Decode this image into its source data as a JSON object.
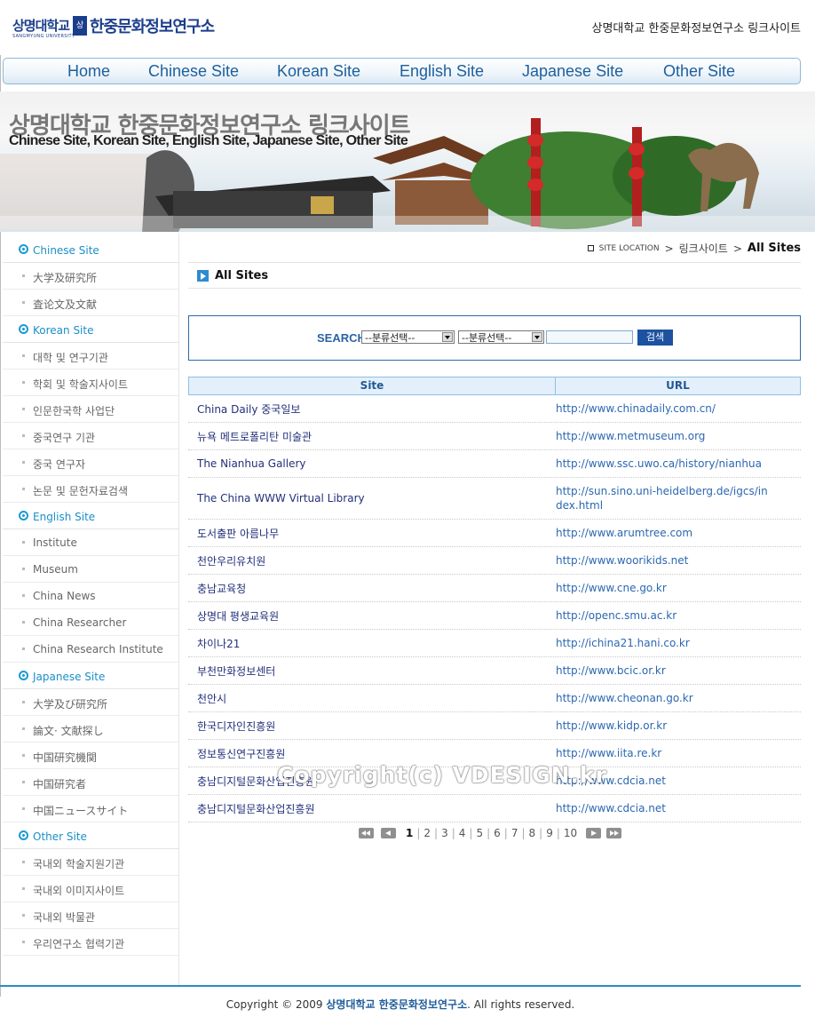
{
  "header": {
    "logo_univ": "상명대학교",
    "logo_univ_sub": "SANGMYUNG UNIVERSITY",
    "logo_seal": "상명",
    "logo_inst": "한중문화정보연구소",
    "site_title": "상명대학교 한중문화정보연구소 링크사이트"
  },
  "nav": [
    "Home",
    "Chinese Site",
    "Korean Site",
    "English Site",
    "Japanese Site",
    "Other Site"
  ],
  "banner": {
    "title": "상명대학교 한중문화정보연구소 링크사이트",
    "subtitle": "Chinese Site, Korean Site, English Site, Japanese Site, Other Site"
  },
  "sidebar": {
    "categories": [
      {
        "label": "Chinese Site",
        "items": [
          "大学及研究所",
          "査论文及文献"
        ]
      },
      {
        "label": "Korean Site",
        "items": [
          "대학 및 연구기관",
          "학회 및 학술지사이트",
          "인문한국학 사업단",
          "중국연구 기관",
          "중국 연구자",
          "논문 및 문헌자료검색"
        ]
      },
      {
        "label": "English Site",
        "items": [
          "Institute",
          "Museum",
          "China News",
          "China Researcher",
          "China Research Institute"
        ]
      },
      {
        "label": "Japanese Site",
        "items": [
          "大学及び研究所",
          "論文· 文献探し",
          "中国研究機関",
          "中国研究者",
          "中国ニュースサイト"
        ]
      },
      {
        "label": "Other Site",
        "items": [
          "국내외 학술지원기관",
          "국내외 이미지사이트",
          "국내외 박물관",
          "우리연구소 협력기관"
        ]
      }
    ]
  },
  "location": {
    "label": "SITE LOCATION",
    "sep": ">",
    "crumb": "링크사이트",
    "current": "All Sites"
  },
  "page_title": "All Sites",
  "search": {
    "label": "SEARCH",
    "select1": "--분류선택--",
    "select2": "--분류선택--",
    "query": "",
    "button": "검색"
  },
  "table": {
    "headers": [
      "Site",
      "URL"
    ],
    "rows": [
      {
        "site": "China Daily 중국일보",
        "url": "http://www.chinadaily.com.cn/"
      },
      {
        "site": "뉴욕 메트로폴리탄 미술관",
        "url": "http://www.metmuseum.org"
      },
      {
        "site": "The Nianhua Gallery",
        "url": "http://www.ssc.uwo.ca/history/nianhua"
      },
      {
        "site": "The China WWW Virtual Library",
        "url": "http://sun.sino.uni-heidelberg.de/igcs/index.html"
      },
      {
        "site": "도서출판 아름나무",
        "url": "http://www.arumtree.com"
      },
      {
        "site": "천안우리유치원",
        "url": "http://www.woorikids.net"
      },
      {
        "site": "충남교육청",
        "url": "http://www.cne.go.kr"
      },
      {
        "site": "상명대 평생교육원",
        "url": "http://openc.smu.ac.kr"
      },
      {
        "site": "차이나21",
        "url": "http://ichina21.hani.co.kr"
      },
      {
        "site": "부천만화정보센터",
        "url": "http://www.bcic.or.kr"
      },
      {
        "site": "천안시",
        "url": "http://www.cheonan.go.kr"
      },
      {
        "site": "한국디자인진흥원",
        "url": "http://www.kidp.or.kr"
      },
      {
        "site": "정보통신연구진흥원",
        "url": "http://www.iita.re.kr"
      },
      {
        "site": "충남디지털문화산업진흥원",
        "url": "http://www.cdcia.net"
      },
      {
        "site": "충남디지털문화산업진흥원",
        "url": "http://www.cdcia.net"
      }
    ]
  },
  "watermark": "Copyright(c) VDESIGN.kr",
  "pagination": {
    "current": "1",
    "pages": [
      "1",
      "2",
      "3",
      "4",
      "5",
      "6",
      "7",
      "8",
      "9",
      "10"
    ]
  },
  "footer": {
    "prefix": "Copyright © 2009 ",
    "brand": "상명대학교 한중문화정보연구소",
    "suffix": ". All rights reserved."
  },
  "colors": {
    "accent": "#1a9ad4",
    "nav_text": "#1d5f9c",
    "search_button": "#1d52a0",
    "table_header_bg": "#e3f0fb",
    "footer_line": "#2a8cc5"
  }
}
